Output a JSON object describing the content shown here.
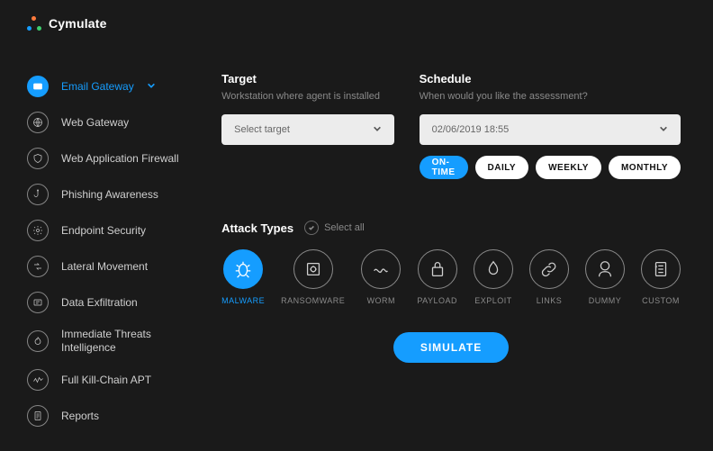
{
  "brand": {
    "name": "Cymulate"
  },
  "sidebar": {
    "items": [
      {
        "label": "Email Gateway",
        "icon": "mail",
        "active": true,
        "expandable": true
      },
      {
        "label": "Web Gateway",
        "icon": "globe"
      },
      {
        "label": "Web Application Firewall",
        "icon": "shield"
      },
      {
        "label": "Phishing Awareness",
        "icon": "hook"
      },
      {
        "label": "Endpoint Security",
        "icon": "gear"
      },
      {
        "label": "Lateral Movement",
        "icon": "lateral"
      },
      {
        "label": "Data Exfiltration",
        "icon": "exfil"
      },
      {
        "label": "Immediate Threats Intelligence",
        "icon": "flame"
      },
      {
        "label": "Full Kill-Chain APT",
        "icon": "chain"
      },
      {
        "label": "Reports",
        "icon": "report"
      }
    ]
  },
  "target": {
    "heading": "Target",
    "subhead": "Workstation where agent is installed",
    "placeholder": "Select target"
  },
  "schedule": {
    "heading": "Schedule",
    "subhead": "When would you like the assessment?",
    "value": "02/06/2019 18:55",
    "options": [
      {
        "label": "ON-TIME",
        "active": true
      },
      {
        "label": "DAILY"
      },
      {
        "label": "WEEKLY"
      },
      {
        "label": "MONTHLY"
      }
    ]
  },
  "attack": {
    "heading": "Attack Types",
    "select_all": "Select all",
    "types": [
      {
        "label": "MALWARE",
        "icon": "bug",
        "active": true
      },
      {
        "label": "RANSOMWARE",
        "icon": "safe"
      },
      {
        "label": "WORM",
        "icon": "worm"
      },
      {
        "label": "PAYLOAD",
        "icon": "payload"
      },
      {
        "label": "EXPLOIT",
        "icon": "exploit"
      },
      {
        "label": "LINKS",
        "icon": "link"
      },
      {
        "label": "DUMMY",
        "icon": "dummy"
      },
      {
        "label": "CUSTOM",
        "icon": "custom"
      }
    ]
  },
  "cta": {
    "label": "SIMULATE"
  }
}
